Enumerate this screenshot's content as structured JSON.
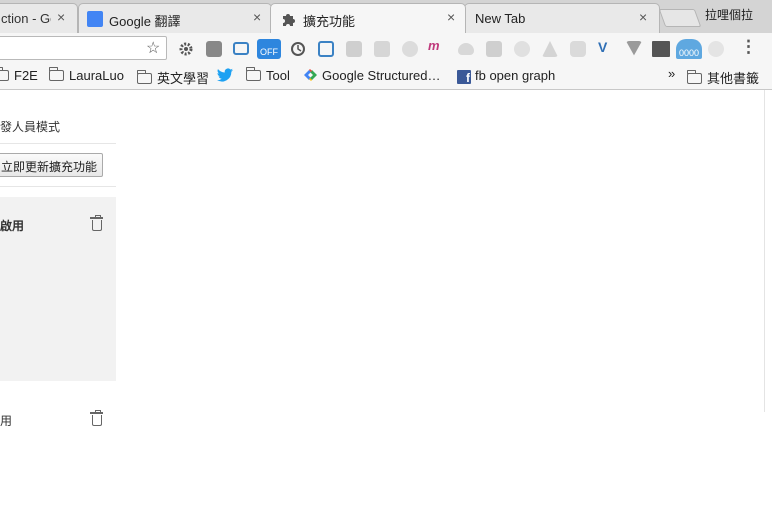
{
  "tabs": [
    {
      "title": "ction - Go",
      "active": false
    },
    {
      "title": "Google 翻譯",
      "active": false
    },
    {
      "title": "擴充功能",
      "active": true
    },
    {
      "title": "New Tab",
      "active": false
    }
  ],
  "close_glyph": "×",
  "profile_name": "拉哩個拉",
  "toolbar": {
    "menu_glyph": "⋮",
    "off_badge": "OFF",
    "counter_badge": "0000"
  },
  "bookmarks": {
    "items": [
      {
        "label": "F2E",
        "icon": "folder-icon"
      },
      {
        "label": "LauraLuo",
        "icon": "folder-icon"
      },
      {
        "label": "英文學習",
        "icon": "folder-icon"
      },
      {
        "label": "",
        "icon": "twitter-bird-icon"
      },
      {
        "label": "Tool",
        "icon": "folder-icon"
      },
      {
        "label": "Google Structured…",
        "icon": "google-icon"
      },
      {
        "label": "fb open graph",
        "icon": "facebook-icon"
      }
    ],
    "overflow": "»",
    "other": "其他書籤"
  },
  "extensions_page": {
    "developer_mode_label": "開發人員模式",
    "update_button": "立即更新擴充功能",
    "cards": [
      {
        "enabled_label": "已啟用"
      },
      {
        "enabled_label": "啟用"
      }
    ]
  },
  "colors": {
    "tabstrip": "#d4d4d4",
    "toolbar": "#f6f6f6",
    "card_bg": "#f2f2f2",
    "google_blue": "#4285f4",
    "twitter_blue": "#1da1f2",
    "facebook_blue": "#3b5998"
  }
}
